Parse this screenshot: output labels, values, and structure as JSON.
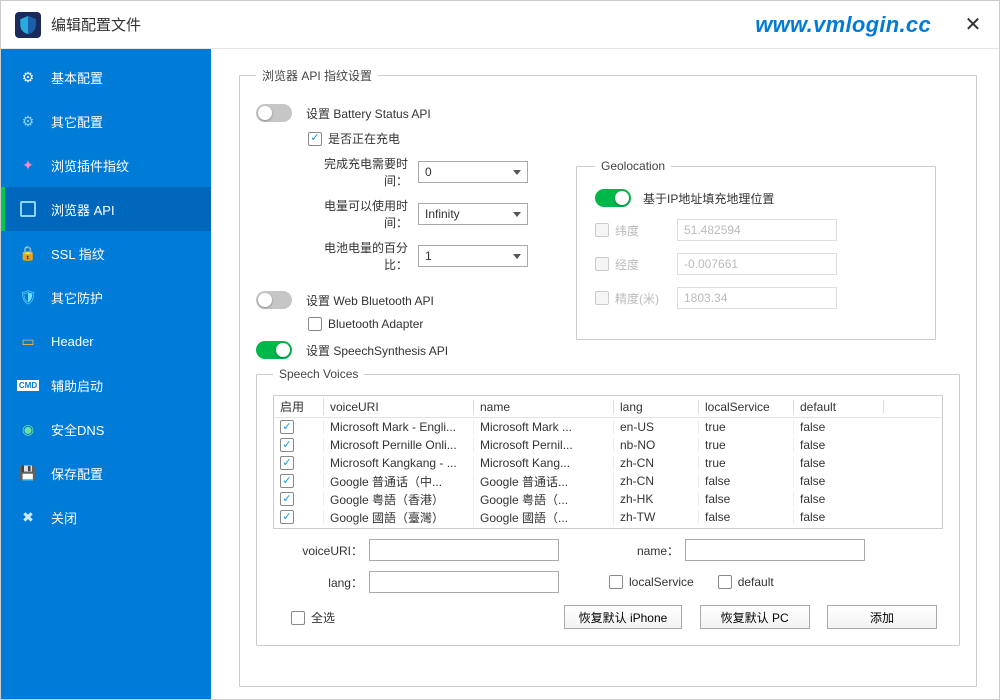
{
  "title": "编辑配置文件",
  "watermark": "www.vmlogin.cc",
  "sidebar": {
    "items": [
      {
        "label": "基本配置"
      },
      {
        "label": "其它配置"
      },
      {
        "label": "浏览插件指纹"
      },
      {
        "label": "浏览器 API"
      },
      {
        "label": "SSL 指纹"
      },
      {
        "label": "其它防护"
      },
      {
        "label": "Header"
      },
      {
        "label": "辅助启动"
      },
      {
        "label": "安全DNS"
      },
      {
        "label": "保存配置"
      },
      {
        "label": "关闭"
      }
    ],
    "active_index": 3
  },
  "fieldset": {
    "title": "浏览器 API 指纹设置",
    "battery": {
      "toggle_label": "设置 Battery Status API",
      "toggle_on": false,
      "charging_label": "是否正在充电",
      "charging_checked": true,
      "charge_time_label": "完成充电需要时间：",
      "charge_time_value": "0",
      "discharge_time_label": "电量可以使用时间：",
      "discharge_time_value": "Infinity",
      "level_label": "电池电量的百分比：",
      "level_value": "1"
    },
    "bluetooth": {
      "toggle_label": "设置 Web Bluetooth API",
      "toggle_on": false,
      "adapter_label": "Bluetooth Adapter",
      "adapter_checked": false
    },
    "speech": {
      "toggle_label": "设置 SpeechSynthesis API",
      "toggle_on": true
    },
    "geo": {
      "title": "Geolocation",
      "fill_label": "基于IP地址填充地理位置",
      "fill_on": true,
      "lat_label": "纬度",
      "lat_value": "51.482594",
      "lng_label": "经度",
      "lng_value": "-0.007661",
      "acc_label": "精度(米)",
      "acc_value": "1803.34"
    },
    "voices": {
      "title": "Speech Voices",
      "headers": {
        "enable": "启用",
        "uri": "voiceURI",
        "name": "name",
        "lang": "lang",
        "local": "localService",
        "default": "default"
      },
      "rows": [
        {
          "checked": true,
          "uri": "Microsoft Mark - Engli...",
          "name": "Microsoft Mark ...",
          "lang": "en-US",
          "local": "true",
          "default": "false"
        },
        {
          "checked": true,
          "uri": "Microsoft Pernille Onli...",
          "name": "Microsoft Pernil...",
          "lang": "nb-NO",
          "local": "true",
          "default": "false"
        },
        {
          "checked": true,
          "uri": "Microsoft Kangkang - ...",
          "name": "Microsoft Kang...",
          "lang": "zh-CN",
          "local": "true",
          "default": "false"
        },
        {
          "checked": true,
          "uri": "Google 普通话（中...",
          "name": "Google 普通话...",
          "lang": "zh-CN",
          "local": "false",
          "default": "false"
        },
        {
          "checked": true,
          "uri": "Google 粤語（香港）",
          "name": "Google 粤語（...",
          "lang": "zh-HK",
          "local": "false",
          "default": "false"
        },
        {
          "checked": true,
          "uri": "Google 國語（臺灣）",
          "name": "Google 國語（...",
          "lang": "zh-TW",
          "local": "false",
          "default": "false"
        }
      ],
      "form": {
        "uri_label": "voiceURI：",
        "name_label": "name：",
        "lang_label": "lang：",
        "local_label": "localService",
        "default_label": "default",
        "select_all": "全选",
        "btn_iphone": "恢复默认 iPhone",
        "btn_pc": "恢复默认 PC",
        "btn_add": "添加"
      }
    }
  }
}
